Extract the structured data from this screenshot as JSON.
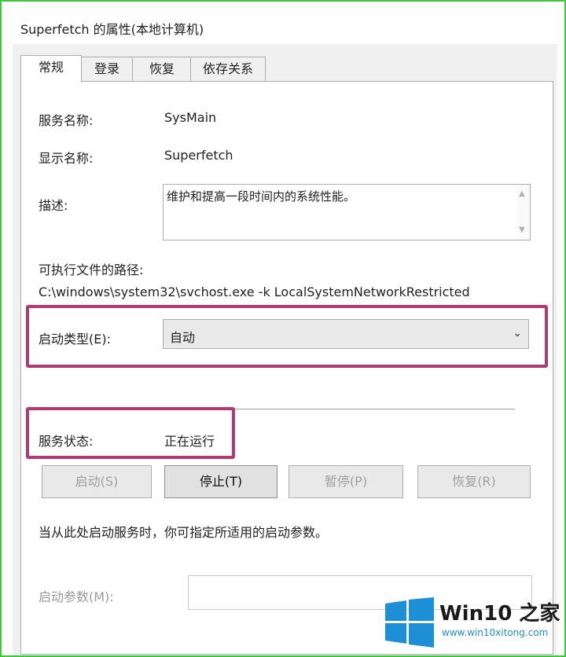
{
  "window": {
    "title": "Superfetch 的属性(本地计算机)"
  },
  "tabs": [
    {
      "label": "常规",
      "active": true
    },
    {
      "label": "登录",
      "active": false
    },
    {
      "label": "恢复",
      "active": false
    },
    {
      "label": "依存关系",
      "active": false
    }
  ],
  "general": {
    "service_name_label": "服务名称:",
    "service_name": "SysMain",
    "display_name_label": "显示名称:",
    "display_name": "Superfetch",
    "description_label": "描述:",
    "description": "维护和提高一段时间内的系统性能。",
    "path_label": "可执行文件的路径:",
    "path": "C:\\windows\\system32\\svchost.exe -k LocalSystemNetworkRestricted",
    "startup_type_label": "启动类型(E):",
    "startup_type": "自动",
    "status_label": "服务状态:",
    "status": "正在运行",
    "buttons": {
      "start": "启动(S)",
      "stop": "停止(T)",
      "pause": "暂停(P)",
      "resume": "恢复(R)"
    },
    "hint": "当从此处启动服务时，你可指定所适用的启动参数。",
    "param_label": "启动参数(M):",
    "param_value": ""
  },
  "watermark": {
    "brand": "Win10 之家",
    "url": "www.win10xitong.com"
  },
  "colors": {
    "highlight": "#b03a74",
    "frame_border": "#3cc83c",
    "logo_blue": "#1d8fd6"
  }
}
